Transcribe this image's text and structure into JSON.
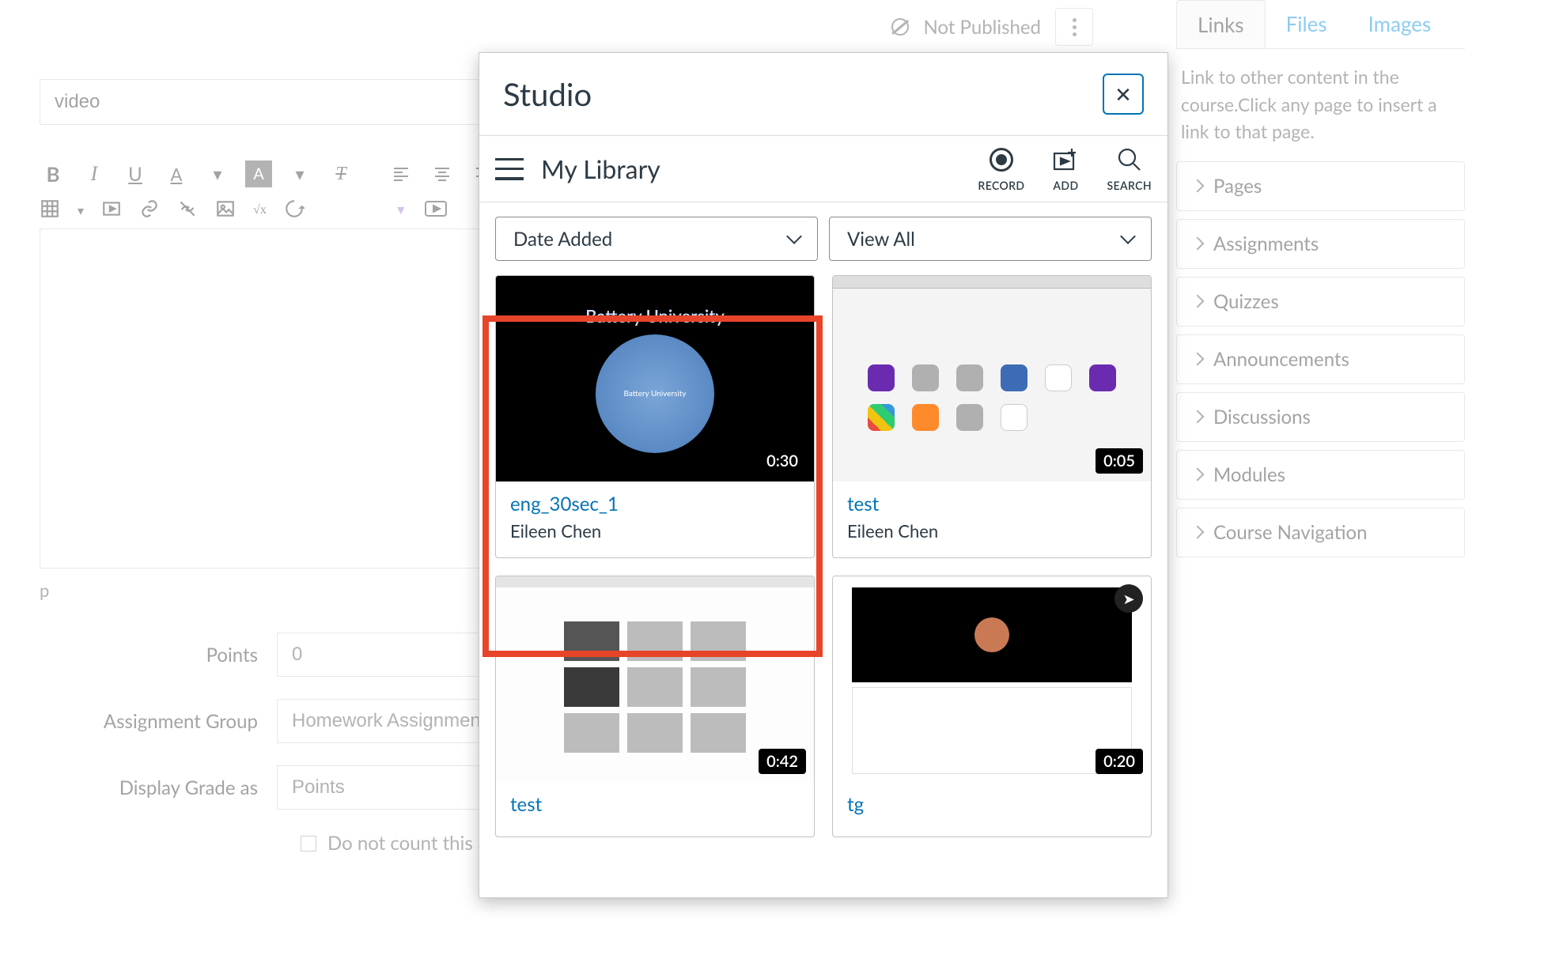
{
  "publish": {
    "status_text": "Not Published"
  },
  "insert_panel": {
    "tabs": [
      {
        "label": "Links",
        "active": true
      },
      {
        "label": "Files",
        "active": false
      },
      {
        "label": "Images",
        "active": false
      }
    ],
    "description": "Link to other content in the course.Click any page to insert a link to that page.",
    "sections": [
      "Pages",
      "Assignments",
      "Quizzes",
      "Announcements",
      "Discussions",
      "Modules",
      "Course Navigation"
    ]
  },
  "editor": {
    "title_value": "video",
    "path": "p",
    "form": {
      "points_label": "Points",
      "points_value": "0",
      "group_label": "Assignment Group",
      "group_value": "Homework Assignment",
      "display_label": "Display Grade as",
      "display_value": "Points",
      "nocount_label": "Do not count this assignment towards the final grade"
    }
  },
  "modal": {
    "title": "Studio",
    "close_label": "✕",
    "breadcrumb": "My Library",
    "actions": {
      "record": "RECORD",
      "add": "ADD",
      "search": "SEARCH"
    },
    "filters": {
      "sort": "Date Added",
      "view": "View All"
    },
    "cards": [
      {
        "title": "eng_30sec_1",
        "author": "Eileen Chen",
        "duration": "0:30"
      },
      {
        "title": "test",
        "author": "Eileen Chen",
        "duration": "0:05"
      },
      {
        "title": "test",
        "author": "",
        "duration": "0:42"
      },
      {
        "title": "tg",
        "author": "",
        "duration": "0:20"
      }
    ],
    "thumbs": {
      "battery_title": "Battery University",
      "battery_center": "Battery University"
    }
  }
}
